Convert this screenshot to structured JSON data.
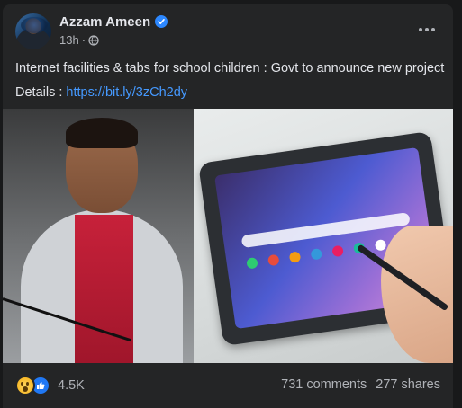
{
  "post": {
    "author": "Azzam Ameen",
    "time": "13h",
    "separator": "·",
    "text_line1": "Internet facilities & tabs for school children : Govt to announce new project",
    "details_label": "Details : ",
    "link": "https://bit.ly/3zCh2dy"
  },
  "footer": {
    "reaction_count": "4.5K",
    "comments": "731 comments",
    "shares": "277 shares"
  },
  "icons": {
    "verified": "verified-badge-icon",
    "privacy": "globe-icon",
    "more": "more-options-icon",
    "reactions": [
      "wow-reaction-icon",
      "like-reaction-icon"
    ]
  },
  "colors": {
    "background": "#18191a",
    "card": "#242526",
    "text_primary": "#e4e6eb",
    "text_secondary": "#b0b3b8",
    "link": "#4599ff",
    "verified": "#2d88ff",
    "like": "#2078f4",
    "wow": "#f7b928"
  }
}
